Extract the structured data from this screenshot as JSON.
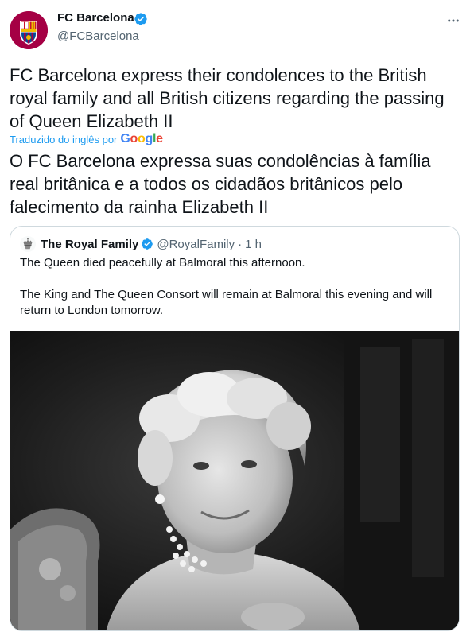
{
  "tweet": {
    "author_name": "FC Barcelona",
    "author_handle": "@FCBarcelona",
    "original_text": "FC Barcelona express their condolences to the British royal family and all British citizens regarding the passing of Queen Elizabeth II",
    "translated_by": "Traduzido do inglês por",
    "google_letters": [
      "G",
      "o",
      "o",
      "g",
      "l",
      "e"
    ],
    "translated_text": "O FC Barcelona expressa suas condolências à família real britânica e a todos os cidadãos britânicos pelo falecimento da rainha Elizabeth II",
    "avatar_crest_text": "FCB",
    "icons": {
      "avatar": "fc-barcelona-crest-icon",
      "verified": "verified-badge-icon",
      "more": "more-options-icon"
    }
  },
  "quote": {
    "name": "The Royal Family",
    "handle": "@RoyalFamily",
    "separator": "·",
    "time": "1 h",
    "text": "The Queen died peacefully at Balmoral this afternoon.\n\nThe King and The Queen Consort will remain at Balmoral this evening and will return to London tomorrow.",
    "photo_description_icon": "black-and-white-portrait-photo",
    "icons": {
      "avatar": "royal-crest-icon",
      "verified": "verified-badge-icon"
    }
  },
  "colors": {
    "accent": "#1d9bf0",
    "text": "#0f1419",
    "muted": "#536471",
    "border": "#cfd9de",
    "barca_red": "#a50044",
    "barca_blue": "#004d98",
    "barca_yellow": "#edbb00"
  }
}
